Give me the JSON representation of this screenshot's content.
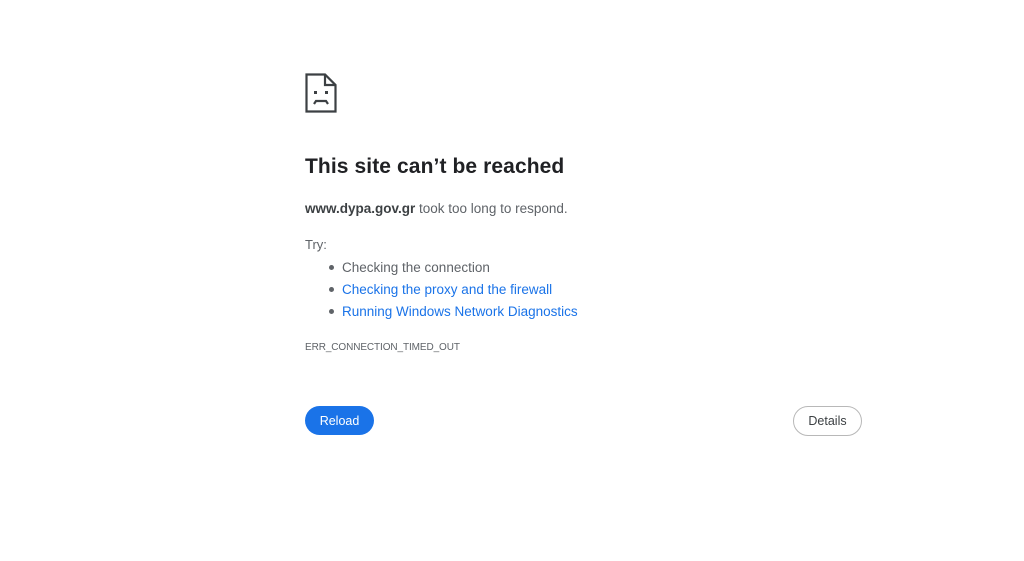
{
  "icon": "sad-page-icon",
  "error": {
    "title": "This site can’t be reached",
    "host": "www.dypa.gov.gr",
    "message": " took too long to respond.",
    "try_label": "Try:",
    "suggestions": [
      {
        "text": "Checking the connection",
        "is_link": false
      },
      {
        "text": "Checking the proxy and the firewall",
        "is_link": true
      },
      {
        "text": "Running Windows Network Diagnostics",
        "is_link": true
      }
    ],
    "code": "ERR_CONNECTION_TIMED_OUT"
  },
  "buttons": {
    "reload_label": "Reload",
    "details_label": "Details"
  },
  "colors": {
    "accent": "#1a73e8",
    "text_primary": "#202124",
    "text_secondary": "#5f6368"
  }
}
